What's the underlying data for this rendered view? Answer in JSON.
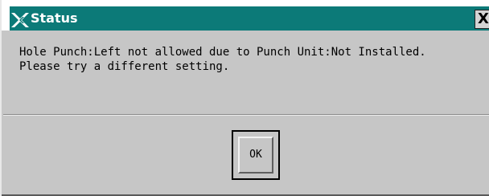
{
  "window": {
    "title": "Status",
    "close_label": "X",
    "title_bar_color": "#0c7a78",
    "background_color": "#c6c6c6"
  },
  "icons": {
    "window_logo": "x-window-logo-icon"
  },
  "message": {
    "line1": "Hole Punch:Left not allowed due to Punch Unit:Not Installed.",
    "line2": "Please try a different setting."
  },
  "buttons": {
    "ok_label": "OK"
  }
}
